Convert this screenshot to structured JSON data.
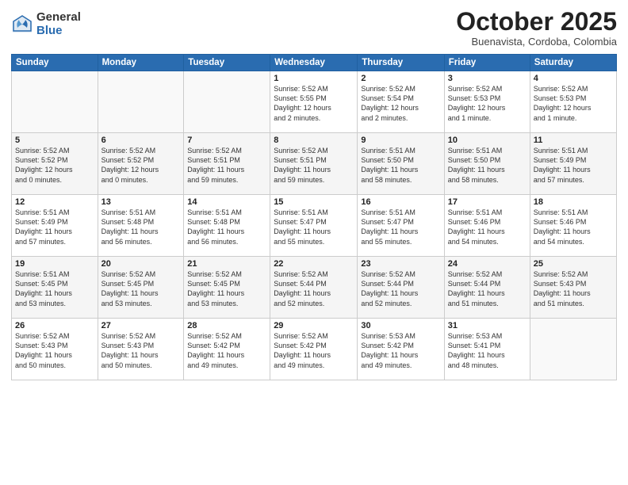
{
  "logo": {
    "general": "General",
    "blue": "Blue"
  },
  "header": {
    "month": "October 2025",
    "location": "Buenavista, Cordoba, Colombia"
  },
  "weekdays": [
    "Sunday",
    "Monday",
    "Tuesday",
    "Wednesday",
    "Thursday",
    "Friday",
    "Saturday"
  ],
  "weeks": [
    [
      {
        "day": "",
        "info": ""
      },
      {
        "day": "",
        "info": ""
      },
      {
        "day": "",
        "info": ""
      },
      {
        "day": "1",
        "info": "Sunrise: 5:52 AM\nSunset: 5:55 PM\nDaylight: 12 hours\nand 2 minutes."
      },
      {
        "day": "2",
        "info": "Sunrise: 5:52 AM\nSunset: 5:54 PM\nDaylight: 12 hours\nand 2 minutes."
      },
      {
        "day": "3",
        "info": "Sunrise: 5:52 AM\nSunset: 5:53 PM\nDaylight: 12 hours\nand 1 minute."
      },
      {
        "day": "4",
        "info": "Sunrise: 5:52 AM\nSunset: 5:53 PM\nDaylight: 12 hours\nand 1 minute."
      }
    ],
    [
      {
        "day": "5",
        "info": "Sunrise: 5:52 AM\nSunset: 5:52 PM\nDaylight: 12 hours\nand 0 minutes."
      },
      {
        "day": "6",
        "info": "Sunrise: 5:52 AM\nSunset: 5:52 PM\nDaylight: 12 hours\nand 0 minutes."
      },
      {
        "day": "7",
        "info": "Sunrise: 5:52 AM\nSunset: 5:51 PM\nDaylight: 11 hours\nand 59 minutes."
      },
      {
        "day": "8",
        "info": "Sunrise: 5:52 AM\nSunset: 5:51 PM\nDaylight: 11 hours\nand 59 minutes."
      },
      {
        "day": "9",
        "info": "Sunrise: 5:51 AM\nSunset: 5:50 PM\nDaylight: 11 hours\nand 58 minutes."
      },
      {
        "day": "10",
        "info": "Sunrise: 5:51 AM\nSunset: 5:50 PM\nDaylight: 11 hours\nand 58 minutes."
      },
      {
        "day": "11",
        "info": "Sunrise: 5:51 AM\nSunset: 5:49 PM\nDaylight: 11 hours\nand 57 minutes."
      }
    ],
    [
      {
        "day": "12",
        "info": "Sunrise: 5:51 AM\nSunset: 5:49 PM\nDaylight: 11 hours\nand 57 minutes."
      },
      {
        "day": "13",
        "info": "Sunrise: 5:51 AM\nSunset: 5:48 PM\nDaylight: 11 hours\nand 56 minutes."
      },
      {
        "day": "14",
        "info": "Sunrise: 5:51 AM\nSunset: 5:48 PM\nDaylight: 11 hours\nand 56 minutes."
      },
      {
        "day": "15",
        "info": "Sunrise: 5:51 AM\nSunset: 5:47 PM\nDaylight: 11 hours\nand 55 minutes."
      },
      {
        "day": "16",
        "info": "Sunrise: 5:51 AM\nSunset: 5:47 PM\nDaylight: 11 hours\nand 55 minutes."
      },
      {
        "day": "17",
        "info": "Sunrise: 5:51 AM\nSunset: 5:46 PM\nDaylight: 11 hours\nand 54 minutes."
      },
      {
        "day": "18",
        "info": "Sunrise: 5:51 AM\nSunset: 5:46 PM\nDaylight: 11 hours\nand 54 minutes."
      }
    ],
    [
      {
        "day": "19",
        "info": "Sunrise: 5:51 AM\nSunset: 5:45 PM\nDaylight: 11 hours\nand 53 minutes."
      },
      {
        "day": "20",
        "info": "Sunrise: 5:52 AM\nSunset: 5:45 PM\nDaylight: 11 hours\nand 53 minutes."
      },
      {
        "day": "21",
        "info": "Sunrise: 5:52 AM\nSunset: 5:45 PM\nDaylight: 11 hours\nand 53 minutes."
      },
      {
        "day": "22",
        "info": "Sunrise: 5:52 AM\nSunset: 5:44 PM\nDaylight: 11 hours\nand 52 minutes."
      },
      {
        "day": "23",
        "info": "Sunrise: 5:52 AM\nSunset: 5:44 PM\nDaylight: 11 hours\nand 52 minutes."
      },
      {
        "day": "24",
        "info": "Sunrise: 5:52 AM\nSunset: 5:44 PM\nDaylight: 11 hours\nand 51 minutes."
      },
      {
        "day": "25",
        "info": "Sunrise: 5:52 AM\nSunset: 5:43 PM\nDaylight: 11 hours\nand 51 minutes."
      }
    ],
    [
      {
        "day": "26",
        "info": "Sunrise: 5:52 AM\nSunset: 5:43 PM\nDaylight: 11 hours\nand 50 minutes."
      },
      {
        "day": "27",
        "info": "Sunrise: 5:52 AM\nSunset: 5:43 PM\nDaylight: 11 hours\nand 50 minutes."
      },
      {
        "day": "28",
        "info": "Sunrise: 5:52 AM\nSunset: 5:42 PM\nDaylight: 11 hours\nand 49 minutes."
      },
      {
        "day": "29",
        "info": "Sunrise: 5:52 AM\nSunset: 5:42 PM\nDaylight: 11 hours\nand 49 minutes."
      },
      {
        "day": "30",
        "info": "Sunrise: 5:53 AM\nSunset: 5:42 PM\nDaylight: 11 hours\nand 49 minutes."
      },
      {
        "day": "31",
        "info": "Sunrise: 5:53 AM\nSunset: 5:41 PM\nDaylight: 11 hours\nand 48 minutes."
      },
      {
        "day": "",
        "info": ""
      }
    ]
  ]
}
